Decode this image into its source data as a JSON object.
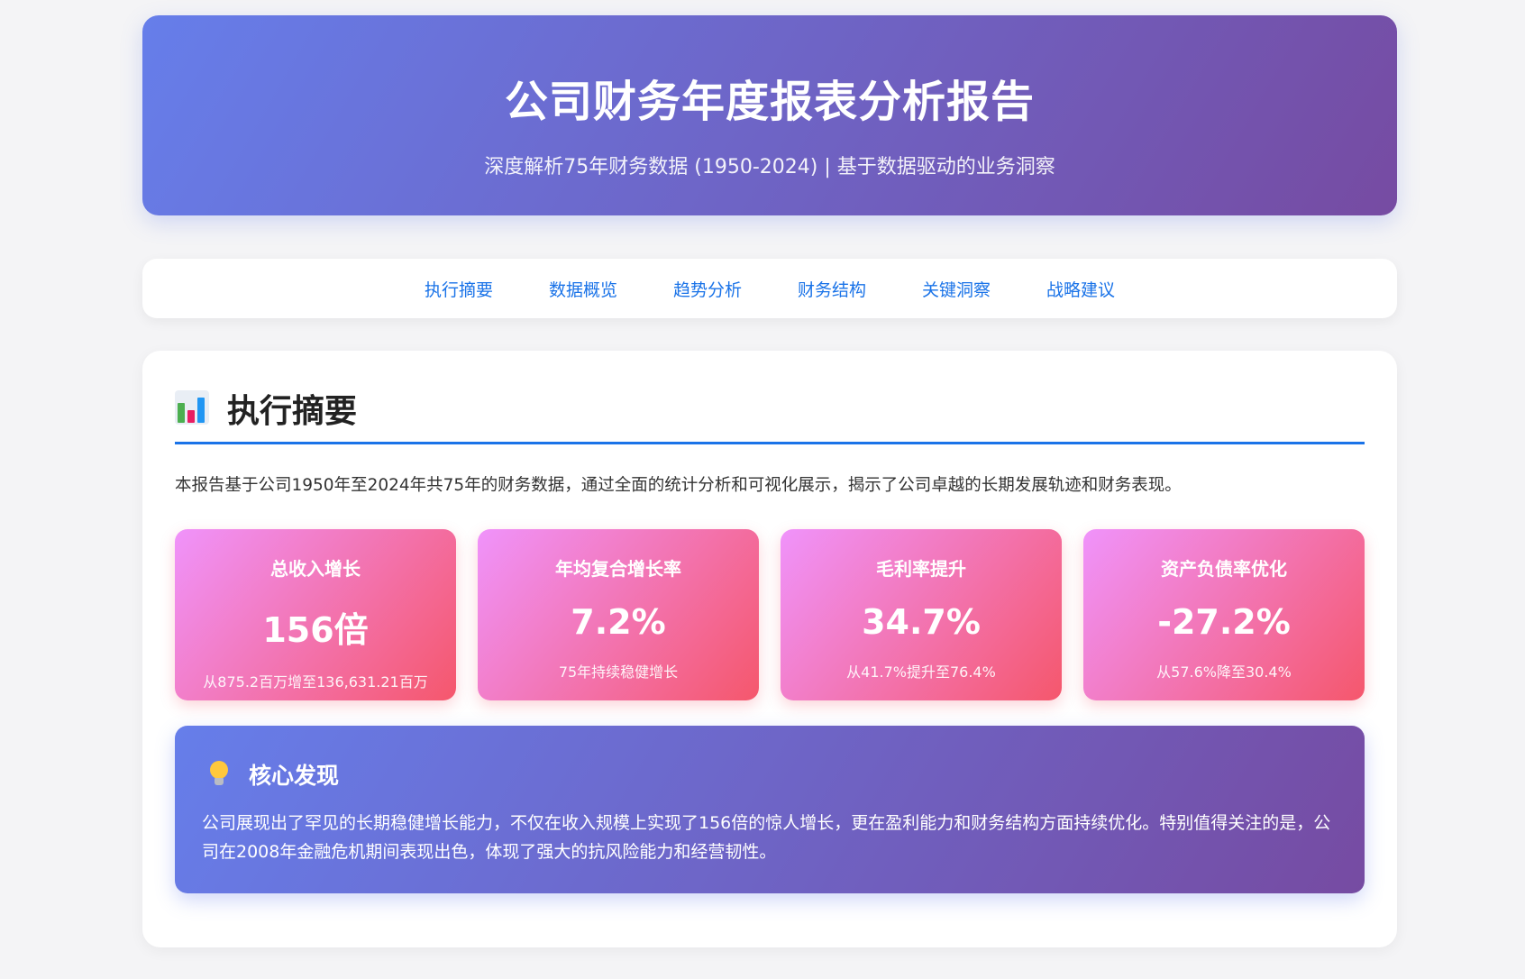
{
  "header": {
    "title": "公司财务年度报表分析报告",
    "subtitle": "深度解析75年财务数据 (1950-2024) | 基于数据驱动的业务洞察"
  },
  "nav": {
    "items": [
      "执行摘要",
      "数据概览",
      "趋势分析",
      "财务结构",
      "关键洞察",
      "战略建议"
    ]
  },
  "summary": {
    "icon": "bar-chart-icon",
    "title": "执行摘要",
    "intro": "本报告基于公司1950年至2024年共75年的财务数据，通过全面的统计分析和可视化展示，揭示了公司卓越的长期发展轨迹和财务表现。",
    "cards": [
      {
        "title": "总收入增长",
        "value": "156倍",
        "desc": "从875.2百万增至136,631.21百万"
      },
      {
        "title": "年均复合增长率",
        "value": "7.2%",
        "desc": "75年持续稳健增长"
      },
      {
        "title": "毛利率提升",
        "value": "34.7%",
        "desc": "从41.7%提升至76.4%"
      },
      {
        "title": "资产负债率优化",
        "value": "-27.2%",
        "desc": "从57.6%降至30.4%"
      }
    ],
    "finding": {
      "icon": "lightbulb-icon",
      "title": "核心发现",
      "text": "公司展现出了罕见的长期稳健增长能力，不仅在收入规模上实现了156倍的惊人增长，更在盈利能力和财务结构方面持续优化。特别值得关注的是，公司在2008年金融危机期间表现出色，体现了强大的抗风险能力和经营韧性。"
    }
  },
  "colors": {
    "header_gradient": [
      "#667eea",
      "#764ba2"
    ],
    "card_gradient": [
      "#f093fb",
      "#f5576c"
    ],
    "accent": "#1a73e8"
  }
}
